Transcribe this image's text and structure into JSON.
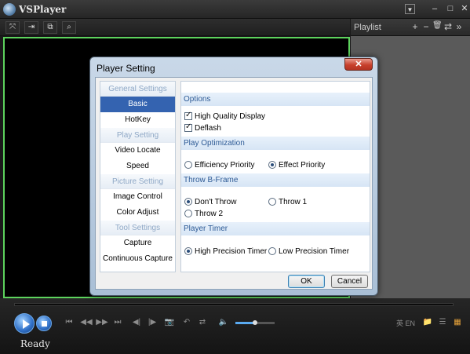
{
  "app": {
    "title": "VSPlayer",
    "status": "Ready"
  },
  "window_controls": {
    "menu": "▼",
    "minimize": "–",
    "maximize": "□",
    "close": "✕"
  },
  "toolbar": {
    "fullscreen_icon": "fullscreen-icon",
    "pin_icon": "pin-icon",
    "snapshot_icon": "window-icon",
    "zoom_icon": "search-icon",
    "glyphs": [
      "⤧",
      "⇥",
      "⧉",
      "⌕"
    ]
  },
  "playlist": {
    "title": "Playlist",
    "add": "+",
    "remove": "−",
    "delete": "🗑",
    "sort": "⇄",
    "more": "»"
  },
  "controls": {
    "glyphs": [
      "⏮",
      "◀◀",
      "▶▶",
      "⏭",
      "◀|",
      "|▶",
      "📷",
      "↶",
      "⇄",
      "🔈"
    ],
    "right_icons": [
      "英 EN",
      "📁",
      "☰",
      "▦"
    ],
    "volume_level": 0.5,
    "accent_color": "#5aaaf0",
    "video_border_color": "#5dd35d"
  },
  "dialog": {
    "title": "Player Setting",
    "close": "✕",
    "nav": {
      "group_general": "General Settings",
      "basic": "Basic",
      "hotkey": "HotKey",
      "group_play": "Play Setting",
      "video_locate": "Video Locate",
      "speed": "Speed",
      "group_picture": "Picture Setting",
      "image_control": "Image Control",
      "color_adjust": "Color Adjust",
      "group_tool": "Tool Settings",
      "capture": "Capture",
      "continuous_capture": "Continuous Capture"
    },
    "options": {
      "header": "Options",
      "high_quality": "High Quality Display",
      "high_quality_checked": true,
      "deflash": "Deflash",
      "deflash_checked": true
    },
    "play_optimization": {
      "header": "Play Optimization",
      "efficiency": "Efficiency Priority",
      "effect": "Effect Priority",
      "selected": "effect"
    },
    "throw_b_frame": {
      "header": "Throw B-Frame",
      "dont_throw": "Don't Throw",
      "throw1": "Throw 1",
      "throw2": "Throw 2",
      "selected": "dont_throw"
    },
    "player_timer": {
      "header": "Player Timer",
      "high": "High Precision Timer",
      "low": "Low Precision Timer",
      "selected": "high"
    },
    "ok": "OK",
    "cancel": "Cancel"
  }
}
